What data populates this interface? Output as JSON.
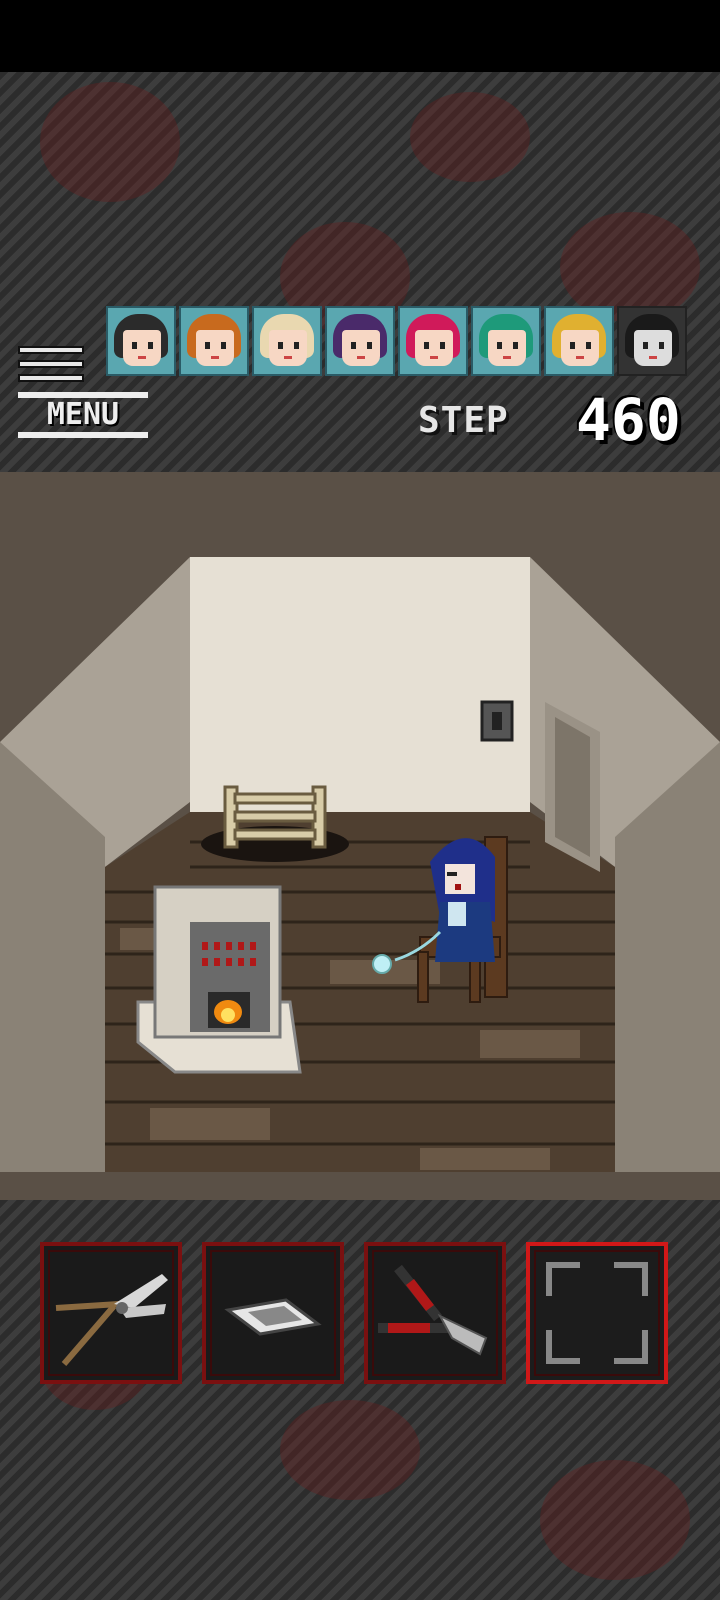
{
  "hud": {
    "menu_label": "MENU",
    "step_label": "STEP",
    "step_value": "460"
  },
  "party": [
    {
      "name": "",
      "hair": "#2b2b2b",
      "status": "alive"
    },
    {
      "name": "",
      "hair": "#c86a1e",
      "status": "alive"
    },
    {
      "name": "",
      "hair": "#e9d8b0",
      "status": "alive"
    },
    {
      "name": "",
      "hair": "#4a2a6a",
      "status": "alive"
    },
    {
      "name": "",
      "hair": "#d01a5a",
      "status": "alive"
    },
    {
      "name": "",
      "hair": "#1e9a7a",
      "status": "alive"
    },
    {
      "name": "",
      "hair": "#e0b030",
      "status": "alive"
    },
    {
      "name": "",
      "hair": "#1a1a1a",
      "status": "dead"
    }
  ],
  "scene": {
    "objects": [
      "ladder-hole",
      "stove",
      "chair",
      "girl-blue-hair",
      "light-switch",
      "side-door"
    ]
  },
  "inventory": [
    {
      "item": "pruning-shears",
      "selected": false
    },
    {
      "item": "photo-card",
      "selected": false
    },
    {
      "item": "bolt-cutter",
      "selected": false
    },
    {
      "item": "",
      "selected": true
    }
  ],
  "colors": {
    "accent": "#d01818",
    "slot_border": "#7a1010",
    "wall": "#e6e0d4",
    "floor": "#4f3f30"
  }
}
